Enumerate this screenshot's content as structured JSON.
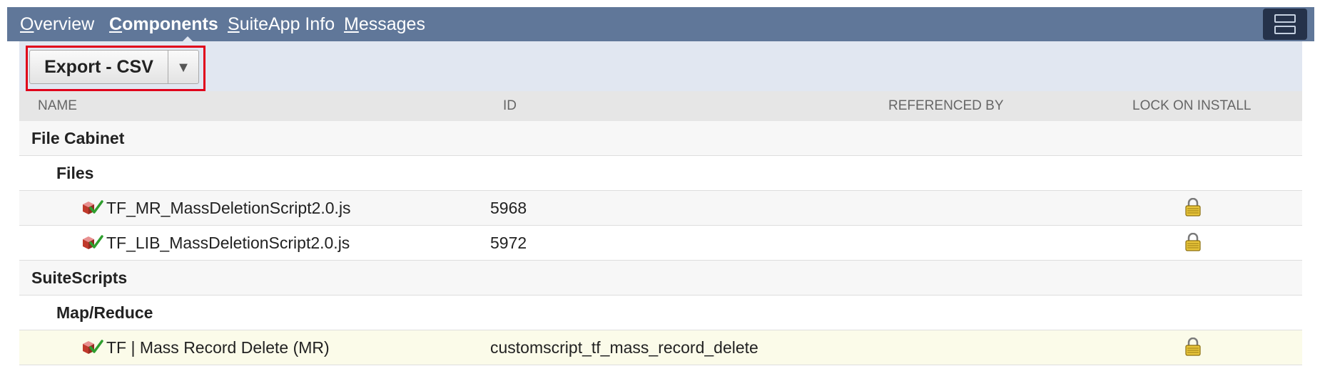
{
  "tabs": [
    {
      "mnemonic": "O",
      "rest": "verview",
      "active": false
    },
    {
      "mnemonic": "C",
      "rest": "omponents",
      "active": true
    },
    {
      "mnemonic": "S",
      "rest": "uiteApp Info",
      "active": false
    },
    {
      "mnemonic": "M",
      "rest": "essages",
      "active": false
    }
  ],
  "toolbar": {
    "export_label": "Export - CSV",
    "dropdown_glyph": "▼"
  },
  "table": {
    "headers": [
      "NAME",
      "ID",
      "REFERENCED BY",
      "LOCK ON INSTALL"
    ],
    "rows": [
      {
        "name": "File Cabinet"
      },
      {
        "name": "Files"
      },
      {
        "name": "TF_MR_MassDeletionScript2.0.js",
        "id": "5968"
      },
      {
        "name": "TF_LIB_MassDeletionScript2.0.js",
        "id": "5972"
      },
      {
        "name": "SuiteScripts"
      },
      {
        "name": "Map/Reduce"
      },
      {
        "name": "TF | Mass Record Delete (MR)",
        "id": "customscript_tf_mass_record_delete"
      }
    ]
  },
  "icons": {
    "bundle": "bundle-component-icon",
    "lock": "lock-icon",
    "menu": "layout-toggle-icon"
  },
  "colors": {
    "tabbar": "#607799",
    "toolbar": "#e1e7f1",
    "highlight_border": "#e0001b",
    "header_bg": "#e6e6e6",
    "highlight_row": "#fbfbe9"
  }
}
